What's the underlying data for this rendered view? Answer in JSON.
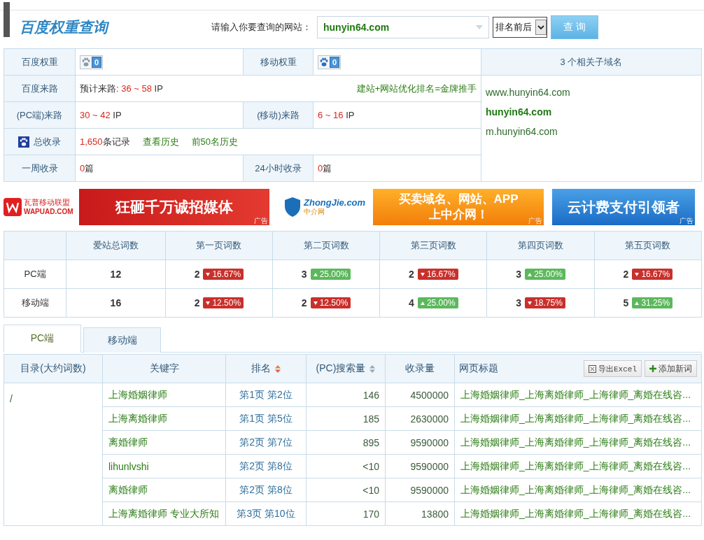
{
  "header": {
    "title": "百度权重查询",
    "query_label": "请输入你要查询的网站：",
    "query_value": "hunyin64.com",
    "sort_select": "排名前后",
    "query_button": "查 询"
  },
  "overview": {
    "baidu_weight": {
      "label": "百度权重",
      "value": "0"
    },
    "mobile_weight": {
      "label": "移动权重",
      "value": "0"
    },
    "baidu_traffic": {
      "label": "百度来路",
      "prefix": "预计来路:",
      "range": "36 ~ 58",
      "unit": "IP",
      "promo_link": "建站+网站优化排名=金牌推手"
    },
    "pc_traffic": {
      "label": "(PC端)来路",
      "range": "30 ~ 42",
      "unit": "IP"
    },
    "mobile_traffic": {
      "label": "(移动)来路",
      "range": "6 ~ 16",
      "unit": "IP"
    },
    "total_indexed": {
      "label": "总收录",
      "count": "1,650",
      "unit": "条记录",
      "links": [
        "查看历史",
        "前50名历史"
      ]
    },
    "week_indexed": {
      "label": "一周收录",
      "count": "0",
      "unit": "篇"
    },
    "day_indexed": {
      "label": "24小时收录",
      "count": "0",
      "unit": "篇"
    }
  },
  "subdomains": {
    "title": "3 个相关子域名",
    "items": [
      {
        "name": "www.hunyin64.com",
        "selected": false
      },
      {
        "name": "hunyin64.com",
        "selected": true
      },
      {
        "name": "m.hunyin64.com",
        "selected": false
      }
    ]
  },
  "ads": [
    {
      "kind": "wapuad",
      "logo_text": "瓦普移动联盟",
      "logo_sub": "WAPUAD.COM",
      "slogan": [
        "狂砸千万诚招媒体"
      ],
      "tag": "广告"
    },
    {
      "kind": "zhongjie",
      "logo_text": "ZhongJie.com",
      "logo_sub": "中介网",
      "slogan": [
        "买卖域名、网站、APP",
        "上中介网！"
      ],
      "tag": "广告"
    },
    {
      "kind": "cloud",
      "slogan": [
        "云计费支付引领者"
      ],
      "tag": "广告"
    }
  ],
  "rank_stats": {
    "columns": [
      "爱站总词数",
      "第一页词数",
      "第二页词数",
      "第三页词数",
      "第四页词数",
      "第五页词数"
    ],
    "rows": [
      {
        "label": "PC端",
        "total": "12",
        "pages": [
          {
            "count": "2",
            "change": "16.67%",
            "rising": false
          },
          {
            "count": "3",
            "change": "25.00%",
            "rising": true
          },
          {
            "count": "2",
            "change": "16.67%",
            "rising": false
          },
          {
            "count": "3",
            "change": "25.00%",
            "rising": true
          },
          {
            "count": "2",
            "change": "16.67%",
            "rising": false
          }
        ]
      },
      {
        "label": "移动端",
        "total": "16",
        "pages": [
          {
            "count": "2",
            "change": "12.50%",
            "rising": false
          },
          {
            "count": "2",
            "change": "12.50%",
            "rising": false
          },
          {
            "count": "4",
            "change": "25.00%",
            "rising": true
          },
          {
            "count": "3",
            "change": "18.75%",
            "rising": false
          },
          {
            "count": "5",
            "change": "31.25%",
            "rising": true
          }
        ]
      }
    ]
  },
  "tabs": [
    {
      "label": "PC端",
      "selected": true
    },
    {
      "label": "移动端",
      "selected": false
    }
  ],
  "keywords": {
    "columns": [
      {
        "label": "目录(大约词数)"
      },
      {
        "label": "关键字"
      },
      {
        "label": "排名",
        "sortable": true,
        "sort_active": true
      },
      {
        "label": "(PC)搜索量",
        "sortable": true,
        "sort_active": false
      },
      {
        "label": "收录量"
      },
      {
        "label": "网页标题"
      }
    ],
    "export_button": "导出Excel",
    "add_button": "添加新词",
    "directory": "/",
    "rows": [
      {
        "keyword": "上海婚姻律师",
        "rank": "第1页 第2位",
        "volume": "146",
        "indexed": "4500000",
        "page_title": "上海婚姻律师_上海离婚律师_上海律师_离婚在线咨..."
      },
      {
        "keyword": "上海离婚律师",
        "rank": "第1页 第5位",
        "volume": "185",
        "indexed": "2630000",
        "page_title": "上海婚姻律师_上海离婚律师_上海律师_离婚在线咨..."
      },
      {
        "keyword": "离婚律师",
        "rank": "第2页 第7位",
        "volume": "895",
        "indexed": "9590000",
        "page_title": "上海婚姻律师_上海离婚律师_上海律师_离婚在线咨..."
      },
      {
        "keyword": "lihunlvshi",
        "rank": "第2页 第8位",
        "volume": "<10",
        "indexed": "9590000",
        "page_title": "上海婚姻律师_上海离婚律师_上海律师_离婚在线咨..."
      },
      {
        "keyword": "离婚律师",
        "rank": "第2页 第8位",
        "volume": "<10",
        "indexed": "9590000",
        "page_title": "上海婚姻律师_上海离婚律师_上海律师_离婚在线咨..."
      },
      {
        "keyword": "上海离婚律师 专业大所知",
        "rank": "第3页 第10位",
        "volume": "170",
        "indexed": "13800",
        "page_title": "上海婚姻律师_上海离婚律师_上海律师_离婚在线咨..."
      }
    ]
  }
}
